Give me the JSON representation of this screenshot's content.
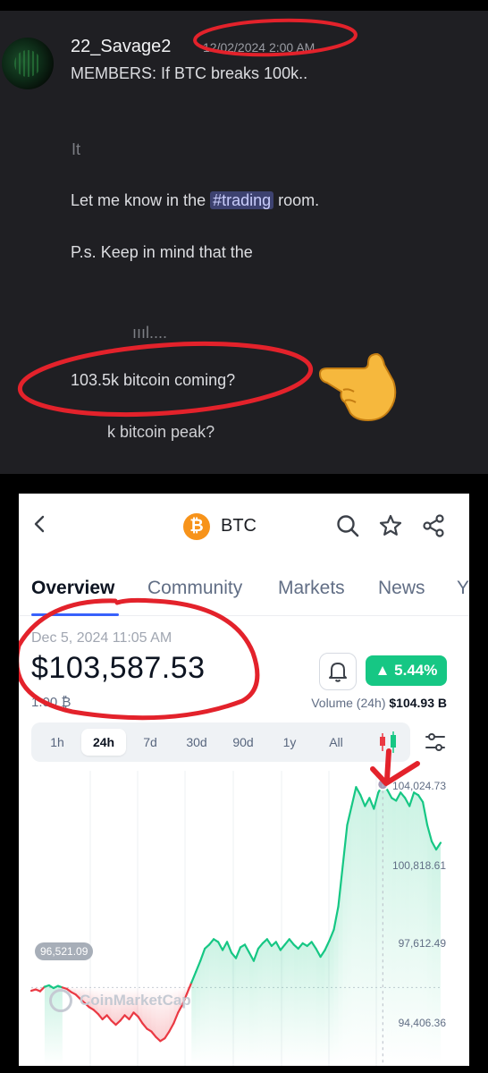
{
  "discord": {
    "username": "22_Savage2",
    "timestamp": "12/02/2024 2:00 AM",
    "line1": "MEMBERS: If BTC breaks 100k..",
    "fragment_a": "It",
    "line_trading_pre": "Let me know in the ",
    "line_trading_tag": "#trading",
    "line_trading_post": " room.",
    "line_ps": "P.s. Keep in mind that the",
    "fragment_b": "ıııl....",
    "question1": "103.5k bitcoin coming?",
    "question2": "k bitcoin peak?"
  },
  "cmc": {
    "symbol": "BTC",
    "coin_glyph": "₿",
    "tabs": [
      "Overview",
      "Community",
      "Markets",
      "News",
      "Y"
    ],
    "date": "Dec 5, 2024 11:05 AM",
    "price": "$103,587.53",
    "btc_amount": "1.00 ₿",
    "change": "5.44%",
    "volume_label": "Volume (24h)",
    "volume_value": "$104.93 B",
    "ranges": [
      "1h",
      "24h",
      "7d",
      "30d",
      "90d",
      "1y",
      "All"
    ],
    "selected_range": "24h",
    "open_label": "96,521.09",
    "watermark": "CoinMarketCap",
    "colors": {
      "up": "#16c784",
      "down": "#ea3943",
      "accent": "#3861fb",
      "annotation": "#e3222b"
    }
  },
  "chart_data": {
    "type": "line",
    "title": "",
    "y_tick_labels": [
      "104,024.73",
      "100,818.61",
      "97,612.49",
      "94,406.36"
    ],
    "ylim": [
      93900,
      104500
    ],
    "baseline": 96521.09,
    "series": [
      {
        "values": [
          96400,
          96450,
          96380,
          96550,
          96600,
          96500,
          96580,
          96521,
          96470,
          96350,
          96260,
          96100,
          95950,
          95800,
          95700,
          95550,
          95350,
          95500,
          95300,
          95150,
          95300,
          95500,
          95350,
          95600,
          95450,
          95200,
          95000,
          94900,
          94700,
          94550,
          94650,
          94900,
          95200,
          95600,
          95900,
          96300,
          96700,
          97100,
          97500,
          97950,
          98100,
          98300,
          98200,
          97900,
          98200,
          97800,
          97600,
          98000,
          98100,
          97800,
          97500,
          97950,
          98150,
          98300,
          98050,
          98200,
          97900,
          98100,
          98300,
          98100,
          97950,
          98150,
          98050,
          98200,
          97950,
          97650,
          97900,
          98250,
          98650,
          99500,
          101000,
          102500,
          103200,
          103900,
          103600,
          103200,
          103500,
          103100,
          103700,
          104000,
          103800,
          103500,
          103400,
          103700,
          103500,
          103200,
          103700,
          103600,
          103350,
          102500,
          101900,
          101600,
          101850
        ]
      }
    ]
  }
}
